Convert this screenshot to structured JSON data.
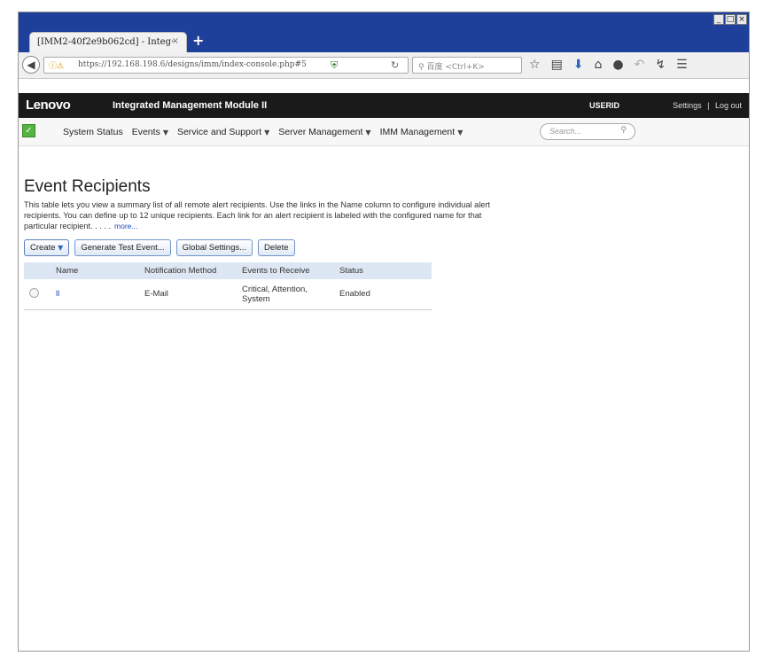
{
  "browser": {
    "tab_title": "[IMM2-40f2e9b062cd] - Integ··",
    "tab_close": "×",
    "new_tab": "+",
    "url": "https://192.168.198.6/designs/imm/index-console.php#5",
    "search_placeholder": "百度 <Ctrl+K>",
    "window_controls": [
      "_",
      "□",
      "×"
    ]
  },
  "header": {
    "logo": "Lenovo",
    "app_title": "Integrated Management Module II",
    "user": "USERID",
    "settings_label": "Settings",
    "separator": "|",
    "logout_label": "Log out"
  },
  "menu": {
    "items": [
      {
        "label": "System Status",
        "dropdown": false
      },
      {
        "label": "Events",
        "dropdown": true
      },
      {
        "label": "Service and Support",
        "dropdown": true
      },
      {
        "label": "Server Management",
        "dropdown": true
      },
      {
        "label": "IMM Management",
        "dropdown": true
      }
    ],
    "search_placeholder": "Search..."
  },
  "page": {
    "title": "Event Recipients",
    "description": "This table lets you view a summary list of all remote alert recipients. Use the links in the Name column to configure individual alert recipients. You can define up to 12 unique recipients. Each link for an alert recipient is labeled with the configured name for that particular recipient. . . . .",
    "more_link": "more...",
    "buttons": {
      "create": "Create",
      "test": "Generate Test Event...",
      "global": "Global Settings...",
      "delete": "Delete"
    },
    "table": {
      "headers": [
        "Name",
        "Notification Method",
        "Events to Receive",
        "Status"
      ],
      "rows": [
        {
          "name": "ll",
          "method": "E-Mail",
          "events": "Critical, Attention, System",
          "status": "Enabled"
        }
      ]
    }
  },
  "colors": {
    "titlebar": "#1e3f9a",
    "header_bg": "#1a1a1a",
    "link": "#2145c2",
    "status_ok": "#55b341",
    "table_header": "#dde7f3"
  }
}
